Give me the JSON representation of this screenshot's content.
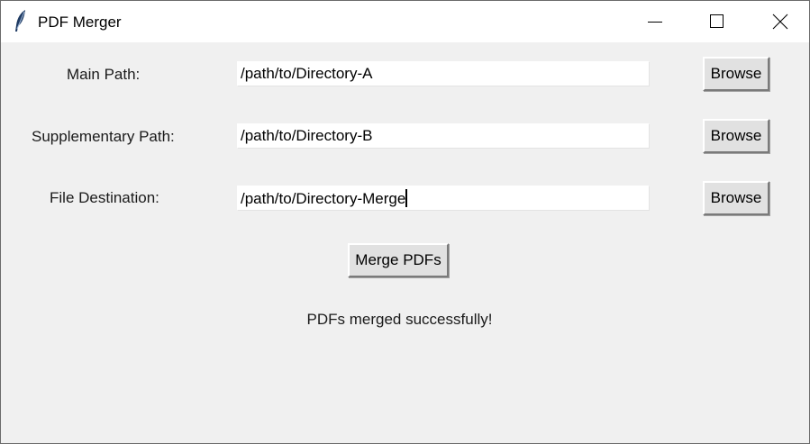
{
  "window": {
    "title": "PDF Merger",
    "controls": [
      "minimize-icon",
      "maximize-icon",
      "close-icon"
    ]
  },
  "form": {
    "main_path": {
      "label": "Main Path:",
      "value": "/path/to/Directory-A",
      "browse_label": "Browse"
    },
    "supplementary_path": {
      "label": "Supplementary Path:",
      "value": "/path/to/Directory-B",
      "browse_label": "Browse"
    },
    "file_destination": {
      "label": "File Destination:",
      "value": "/path/to/Directory-Merge",
      "browse_label": "Browse"
    }
  },
  "actions": {
    "merge_label": "Merge PDFs"
  },
  "status": {
    "message": "PDFs merged successfully!"
  },
  "colors": {
    "window_bg": "#f0f0f0",
    "titlebar_bg": "#ffffff",
    "button_bg": "#e1e1e1"
  }
}
